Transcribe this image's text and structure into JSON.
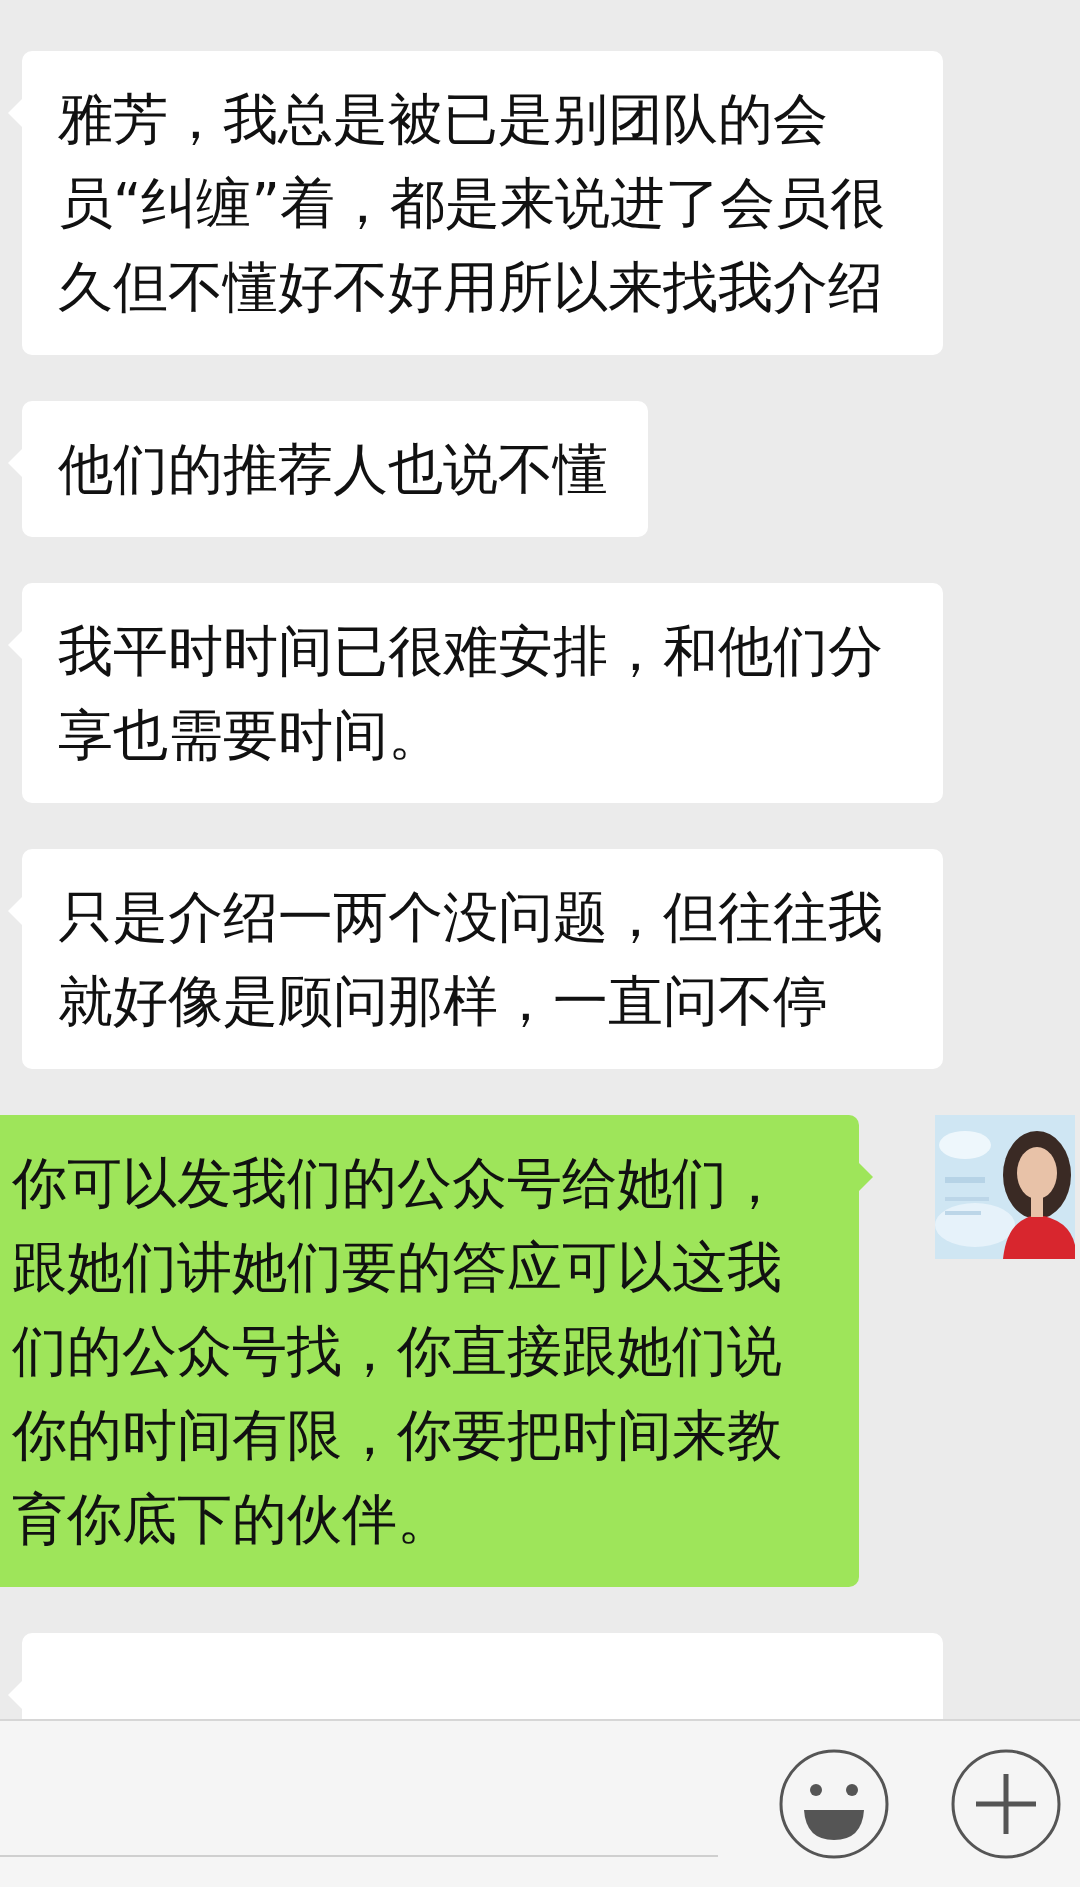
{
  "messages": [
    {
      "kind": "received",
      "text": "雅芳，我总是被已是别团队的会员“纠缠”着，都是来说进了会员很久但不懂好不好用所以来找我介绍"
    },
    {
      "kind": "received",
      "text": "他们的推荐人也说不懂"
    },
    {
      "kind": "received",
      "text": "我平时时间已很难安排，和他们分享也需要时间。"
    },
    {
      "kind": "received",
      "text": "只是介绍一两个没问题，但往往我就好像是顾问那样，一直问不停"
    },
    {
      "kind": "sent",
      "text": "你可以发我们的公众号给她们，跟她们讲她们要的答应可以这我们的公众号找，你直接跟她们说你的时间有限，你要把时间来教育你底下的伙伴。"
    },
    {
      "kind": "received_cut"
    }
  ]
}
